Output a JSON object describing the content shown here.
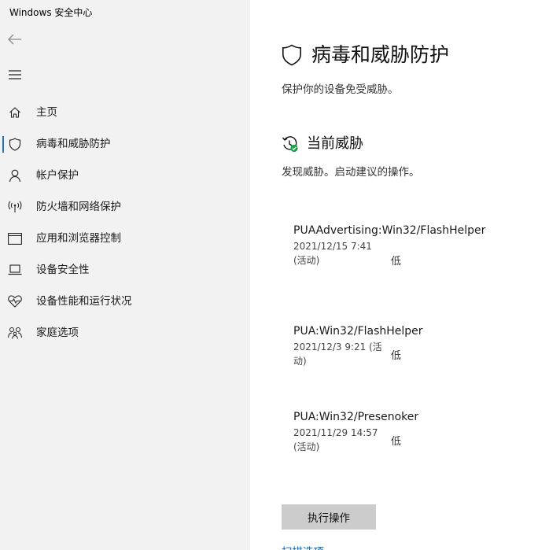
{
  "window": {
    "title": "Windows 安全中心"
  },
  "sidebar": {
    "back_icon": "arrow-left-icon",
    "menu_icon": "hamburger-icon",
    "items": [
      {
        "label": "主页",
        "icon": "home-icon"
      },
      {
        "label": "病毒和威胁防护",
        "icon": "shield-icon",
        "active": true
      },
      {
        "label": "帐户保护",
        "icon": "person-icon"
      },
      {
        "label": "防火墙和网络保护",
        "icon": "antenna-icon"
      },
      {
        "label": "应用和浏览器控制",
        "icon": "browser-window-icon"
      },
      {
        "label": "设备安全性",
        "icon": "laptop-icon"
      },
      {
        "label": "设备性能和运行状况",
        "icon": "heart-pulse-icon"
      },
      {
        "label": "家庭选项",
        "icon": "family-icon"
      }
    ]
  },
  "main": {
    "title": "病毒和威胁防护",
    "subtitle": "保护你的设备免受威胁。",
    "current_threats": {
      "title": "当前威胁",
      "subtitle": "发现威胁。启动建议的操作。",
      "threats": [
        {
          "name": "PUAAdvertising:Win32/FlashHelper",
          "date": "2021/12/15 7:41 (活动)",
          "severity": "低"
        },
        {
          "name": "PUA:Win32/FlashHelper",
          "date": "2021/12/3 9:21 (活动)",
          "severity": "低"
        },
        {
          "name": "PUA:Win32/Presenoker",
          "date": "2021/11/29 14:57 (活动)",
          "severity": "低"
        }
      ],
      "action_button": "执行操作",
      "link_partial": "扫描选项"
    }
  },
  "colors": {
    "sidebar_bg": "#f2f2f2",
    "accent": "#0067c0",
    "button_bg": "#cccccc",
    "status_green": "#16a34a"
  }
}
